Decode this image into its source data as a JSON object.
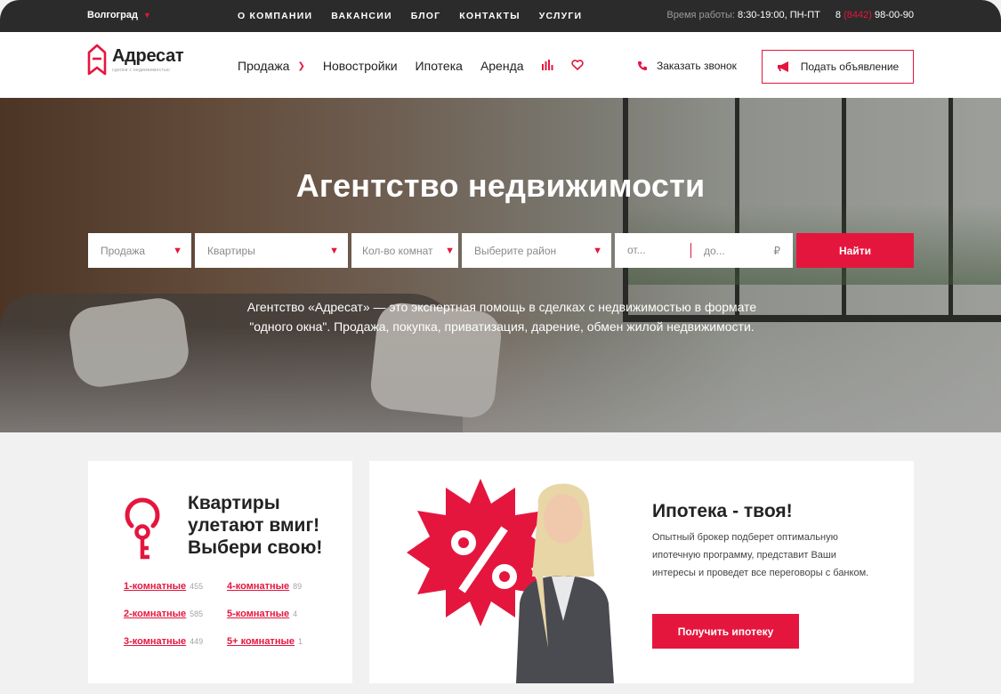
{
  "topbar": {
    "city": "Волгоград",
    "nav": [
      "О КОМПАНИИ",
      "ВАКАНСИИ",
      "БЛОГ",
      "КОНТАКТЫ",
      "УСЛУГИ"
    ],
    "hours_label": "Время работы:",
    "hours_value": "8:30-19:00, ПН-ПТ",
    "phone_prefix": "8 ",
    "phone_code": "(8442)",
    "phone_number": " 98-00-90"
  },
  "header": {
    "logo_name": "Адресат",
    "logo_tagline": "сделки с недвижимостью",
    "nav": {
      "sale": "Продажа",
      "new_buildings": "Новостройки",
      "mortgage": "Ипотека",
      "rent": "Аренда"
    },
    "callback": "Заказать звонок",
    "post_ad": "Подать объявление"
  },
  "hero": {
    "title": "Агентство недвижимости",
    "search": {
      "deal": "Продажа",
      "type": "Квартиры",
      "rooms": "Кол-во комнат",
      "district": "Выберите район",
      "price_from": "от...",
      "price_to": "до...",
      "currency": "₽",
      "submit": "Найти"
    },
    "description_1": "Агентство «Адресат» — это экспертная помощь в сделках с недвижимостью в формате",
    "description_2": "\"одного окна\". Продажа, покупка, приватизация, дарение, обмен жилой недвижимости."
  },
  "rooms_card": {
    "title_1": "Квартиры",
    "title_2": "улетают вмиг!",
    "title_3": "Выбери свою!",
    "items": [
      {
        "label": "1-комнатные",
        "count": "455"
      },
      {
        "label": "2-комнатные",
        "count": "585"
      },
      {
        "label": "3-комнатные",
        "count": "449"
      },
      {
        "label": "4-комнатные",
        "count": "89"
      },
      {
        "label": "5-комнатные",
        "count": "4"
      },
      {
        "label": "5+ комнатные",
        "count": "1"
      }
    ]
  },
  "mortgage_card": {
    "title": "Ипотека - твоя!",
    "text": "Опытный брокер подберет оптимальную ипотечную программу, представит Ваши интересы и проведет все переговоры с банком.",
    "button": "Получить ипотеку"
  },
  "colors": {
    "accent": "#e5163e",
    "topbar": "#2b2b2b",
    "background": "#f1f1f1"
  }
}
